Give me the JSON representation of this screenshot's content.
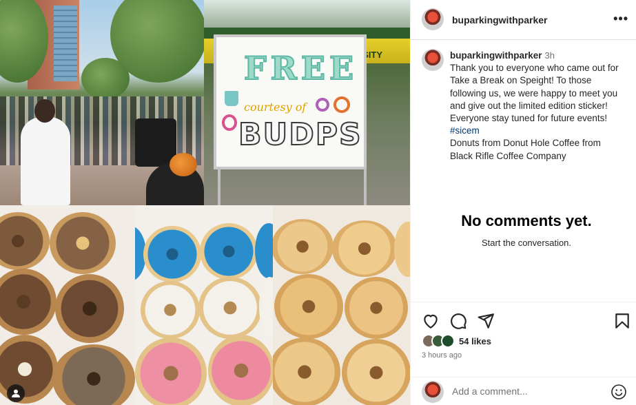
{
  "post": {
    "username": "buparkingwithparker",
    "more_glyph": "•••",
    "caption": {
      "username": "buparkingwithparker",
      "time": "3h",
      "lines": [
        "Thank you to everyone who came out for",
        "Take a Break on Speight! To those",
        "following us, we were happy to meet you",
        "and give out the limited edition sticker!",
        "Everyone stay tuned for future events!"
      ],
      "hashtag": "#sicem",
      "lines2": [
        "Donuts from Donut Hole Coffee from",
        "Black Rifle Coffee Company"
      ]
    },
    "empty_state": {
      "title": "No comments yet.",
      "subtitle": "Start the conversation."
    },
    "likes": "54 likes",
    "posted_ago": "3 hours ago",
    "comment_placeholder": "Add a comment...",
    "icons": [
      "heart-icon",
      "comment-icon",
      "share-icon",
      "bookmark-icon",
      "emoji-icon",
      "more-icon",
      "user-tag-icon"
    ]
  },
  "media": {
    "sign_free": "FREE",
    "sign_courtesy": "courtesy of",
    "sign_budps": "BUDPS",
    "tent_text": "SITY"
  },
  "colors": {
    "accent_hashtag": "#00376b",
    "text_secondary": "#737373",
    "border": "#dbdbdb"
  }
}
